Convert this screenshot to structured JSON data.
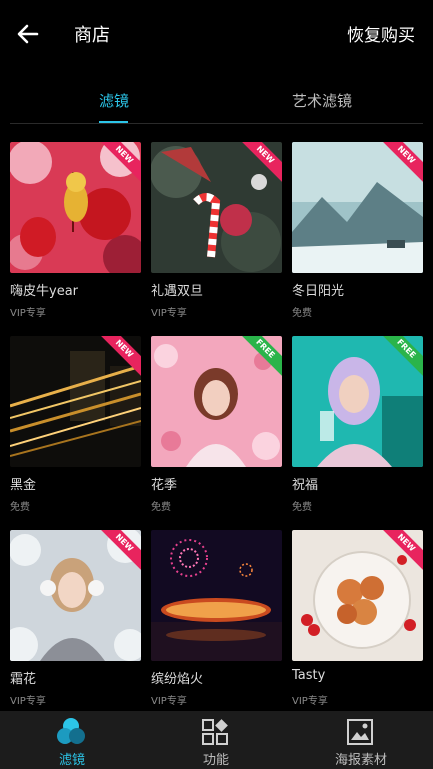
{
  "header": {
    "title": "商店",
    "restore_label": "恢复购买"
  },
  "tabs": [
    {
      "label": "滤镜"
    },
    {
      "label": "艺术滤镜"
    }
  ],
  "items": [
    {
      "name": "嗨皮牛year",
      "price": "VIP专享",
      "badge": "NEW"
    },
    {
      "name": "礼遇双旦",
      "price": "VIP专享",
      "badge": "NEW"
    },
    {
      "name": "冬日阳光",
      "price": "免费",
      "badge": "NEW"
    },
    {
      "name": "黑金",
      "price": "免费",
      "badge": "NEW"
    },
    {
      "name": "花季",
      "price": "免费",
      "badge": "FREE"
    },
    {
      "name": "祝福",
      "price": "免费",
      "badge": "FREE"
    },
    {
      "name": "霜花",
      "price": "VIP专享",
      "badge": "NEW"
    },
    {
      "name": "缤纷焰火",
      "price": "VIP专享",
      "badge": ""
    },
    {
      "name": "Tasty",
      "price": "VIP专享",
      "badge": "NEW"
    }
  ],
  "bottom_nav": [
    {
      "label": "滤镜"
    },
    {
      "label": "功能"
    },
    {
      "label": "海报素材"
    }
  ],
  "colors": {
    "accent": "#2cc5e8",
    "new_badge": "#e8245e",
    "free_badge": "#2ab44a",
    "nav_bg": "#1c1c1c"
  }
}
